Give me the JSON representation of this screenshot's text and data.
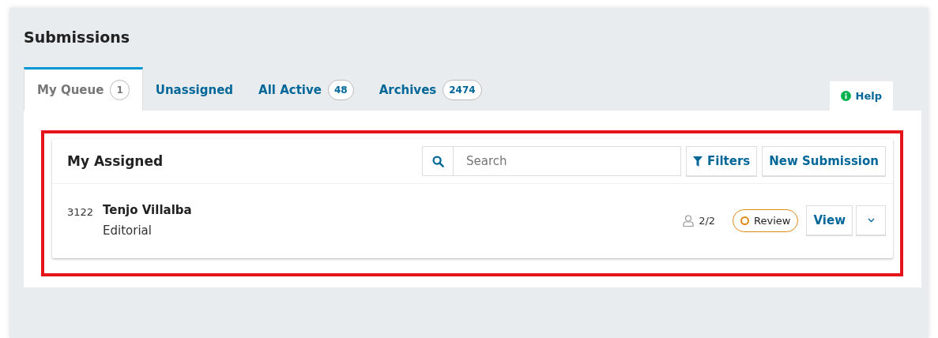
{
  "page_title": "Submissions",
  "tabs": [
    {
      "label": "My Queue",
      "count": "1",
      "selected": true
    },
    {
      "label": "Unassigned",
      "selected": false
    },
    {
      "label": "All Active",
      "count": "48",
      "selected": false
    },
    {
      "label": "Archives",
      "count": "2474",
      "selected": false
    }
  ],
  "help_button": "Help",
  "highlight_box": true,
  "list": {
    "title": "My Assigned",
    "search": {
      "placeholder": "Search"
    },
    "buttons": [
      {
        "kind": "filter",
        "label": "Filters"
      },
      {
        "kind": "plain",
        "label": "New Submission"
      }
    ],
    "items": [
      {
        "id": "3122",
        "author": "Tenjo Villalba",
        "section": "Editorial",
        "participants": "2/2",
        "stage": "Review",
        "view_button": "View",
        "expanded": false
      }
    ]
  }
}
